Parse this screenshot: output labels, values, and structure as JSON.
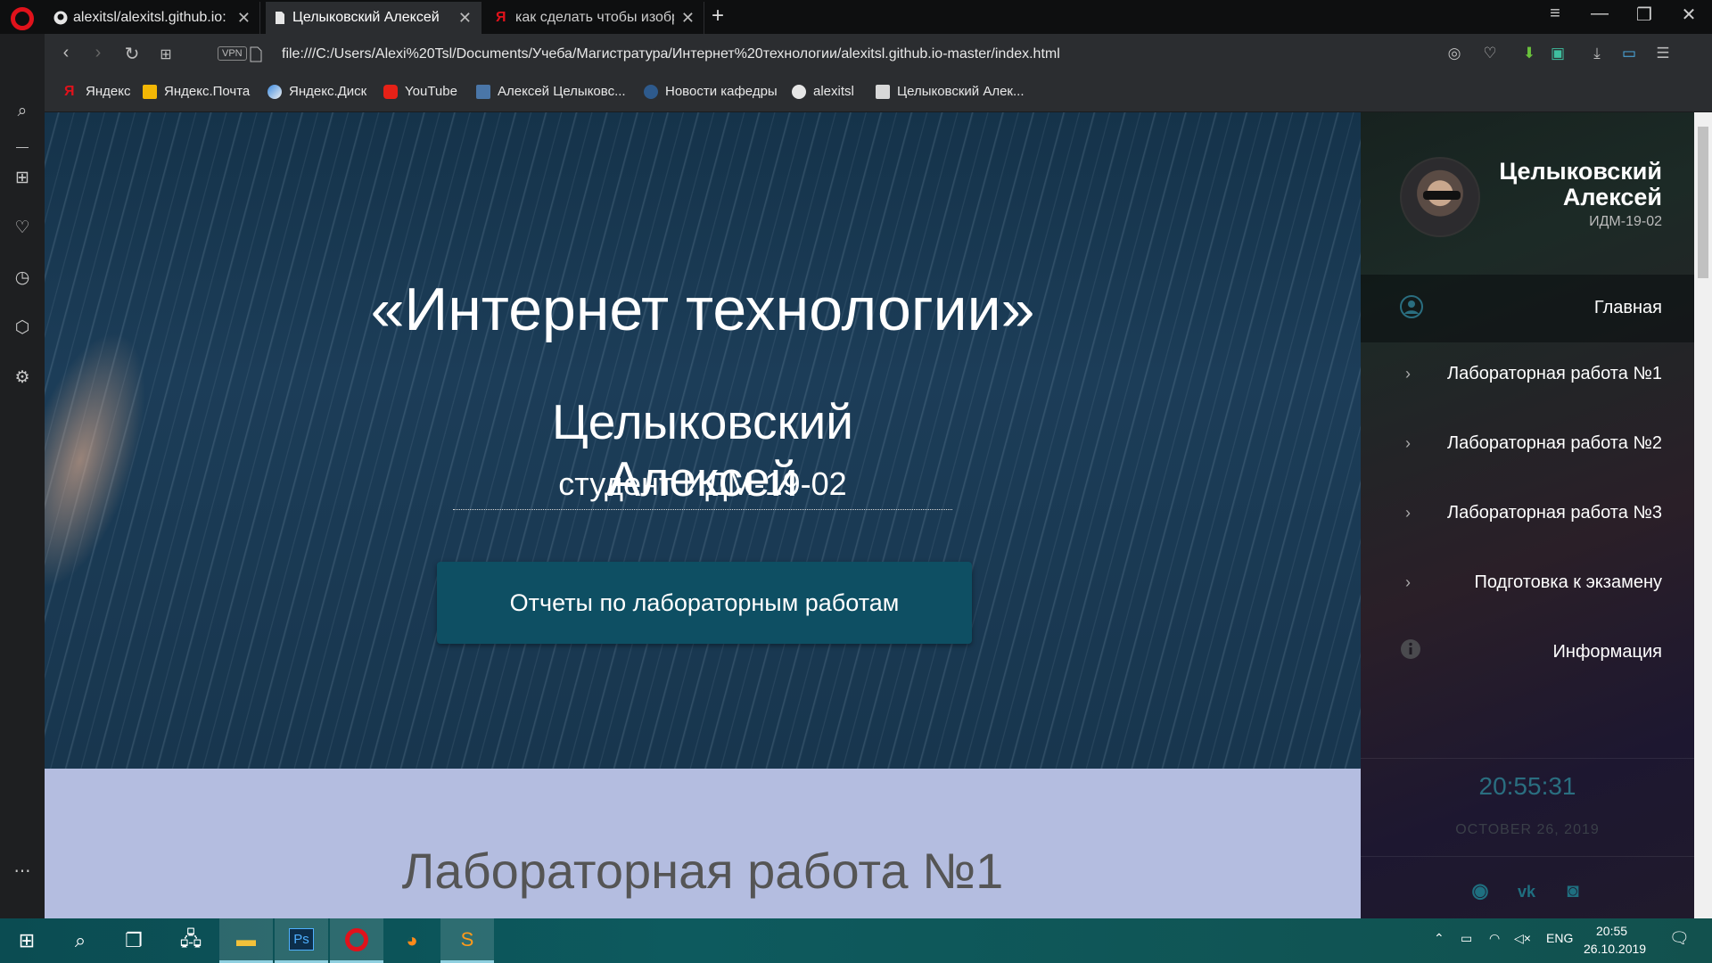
{
  "browser": {
    "tabs": [
      {
        "title": "alexitsl/alexitsl.github.io: Cr",
        "active": false
      },
      {
        "title": "Целыковский Алексей",
        "active": true
      },
      {
        "title": "как сделать чтобы изобра",
        "active": false
      }
    ],
    "url": "file:///C:/Users/Alexi%20Tsl/Documents/Учеба/Магистратура/Интернет%20технологии/alexitsl.github.io-master/index.html",
    "vpn_label": "VPN",
    "bookmarks": [
      {
        "label": "Яндекс"
      },
      {
        "label": "Яндекс.Почта"
      },
      {
        "label": "Яндекс.Диск"
      },
      {
        "label": "YouTube"
      },
      {
        "label": "Алексей Целыковс..."
      },
      {
        "label": "Новости кафедры"
      },
      {
        "label": "alexitsl"
      },
      {
        "label": "Целыковский Алек..."
      }
    ]
  },
  "hero": {
    "title": "«Интернет технологии»",
    "name": "Целыковский Алексей",
    "subtitle": "студент ИДМ-19-02",
    "button": "Отчеты по лабораторным работам"
  },
  "section": {
    "title": "Лабораторная работа №1"
  },
  "panel": {
    "name": "Целыковский Алексей",
    "group": "ИДМ-19-02",
    "nav": [
      {
        "label": "Главная",
        "icon": "user-circle-icon"
      },
      {
        "label": "Лабораторная работа №1",
        "icon": "chevron-right-icon"
      },
      {
        "label": "Лабораторная работа №2",
        "icon": "chevron-right-icon"
      },
      {
        "label": "Лабораторная работа №3",
        "icon": "chevron-right-icon"
      },
      {
        "label": "Подготовка к экзамену",
        "icon": "chevron-right-icon"
      },
      {
        "label": "Информация",
        "icon": "info-icon"
      }
    ],
    "clock": "20:55:31",
    "date": "OCTOBER 26, 2019",
    "social": [
      "github-icon",
      "vk-icon",
      "instagram-icon"
    ]
  },
  "taskbar": {
    "apps": [
      "start-icon",
      "search-icon",
      "task-view-icon",
      "network-icon",
      "file-explorer-icon",
      "photoshop-icon",
      "opera-icon",
      "firefox-icon",
      "sublime-icon"
    ],
    "lang": "ENG",
    "time": "20:55",
    "date": "26.10.2019"
  },
  "colors": {
    "accent_button": "#0e4f63",
    "section_bg": "#b4bde0",
    "clock_color": "#2a6e80",
    "opera_red": "#e0121b"
  }
}
